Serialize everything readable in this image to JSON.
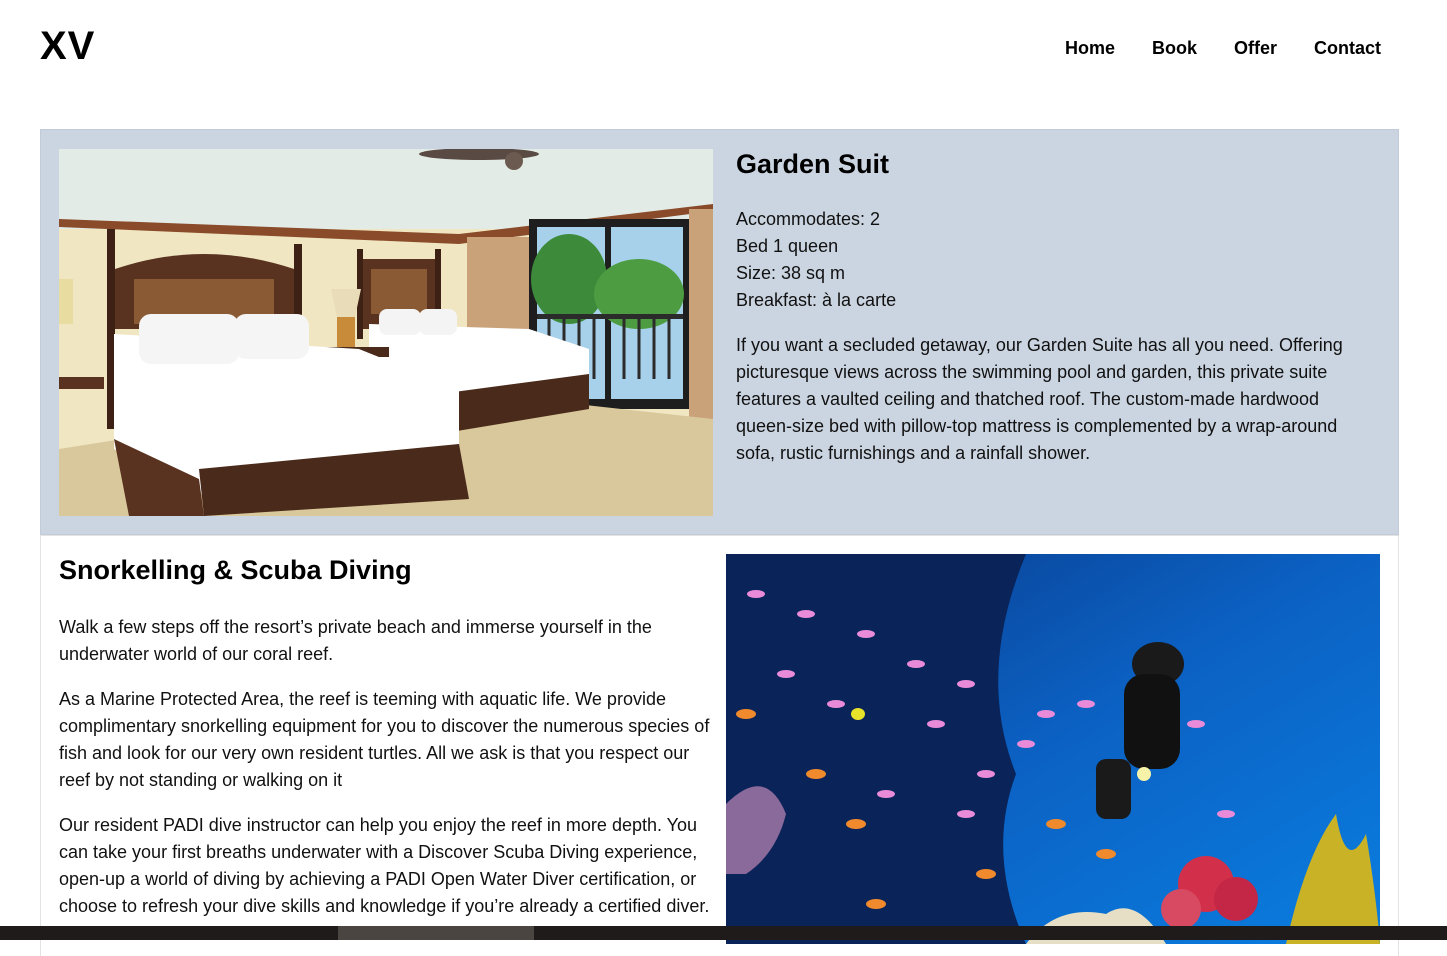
{
  "header": {
    "logo": "XV",
    "nav": [
      {
        "label": "Home"
      },
      {
        "label": "Book"
      },
      {
        "label": "Offer"
      },
      {
        "label": "Contact"
      }
    ]
  },
  "room": {
    "title": "Garden Suit",
    "specs": [
      "Accommodates: 2",
      "Bed 1 queen",
      "Size: 38 sq m",
      "Breakfast: à la carte"
    ],
    "description": "If you want a secluded getaway, our Garden Suite has all you need. Offering picturesque views across the swimming pool and garden, this private suite features a vaulted ceiling and thatched roof. The custom-made hardwood queen-size bed with pillow-top mattress is complemented by a wrap-around sofa, rustic furnishings and a rainfall shower."
  },
  "activity": {
    "title": "Snorkelling & Scuba Diving",
    "paragraphs": [
      "Walk a few steps off the resort’s private beach and immerse yourself in the underwater world of our coral reef.",
      "As a Marine Protected Area, the reef is teeming with aquatic life. We provide complimentary snorkelling equipment for you to discover the numerous species of fish and look for our very own resident turtles. All we ask is that you respect our reef by not standing or walking on it",
      "Our resident PADI dive instructor can help you enjoy the reef in more depth. You can take your first breaths underwater with a Discover Scuba Diving experience, open-up a world of diving by achieving a PADI Open Water Diver certification, or choose to refresh your dive skills and knowledge if you’re already a certified diver."
    ]
  },
  "colors": {
    "card_background": "#cbd5e1",
    "page_background": "#ffffff",
    "text": "#111111"
  }
}
